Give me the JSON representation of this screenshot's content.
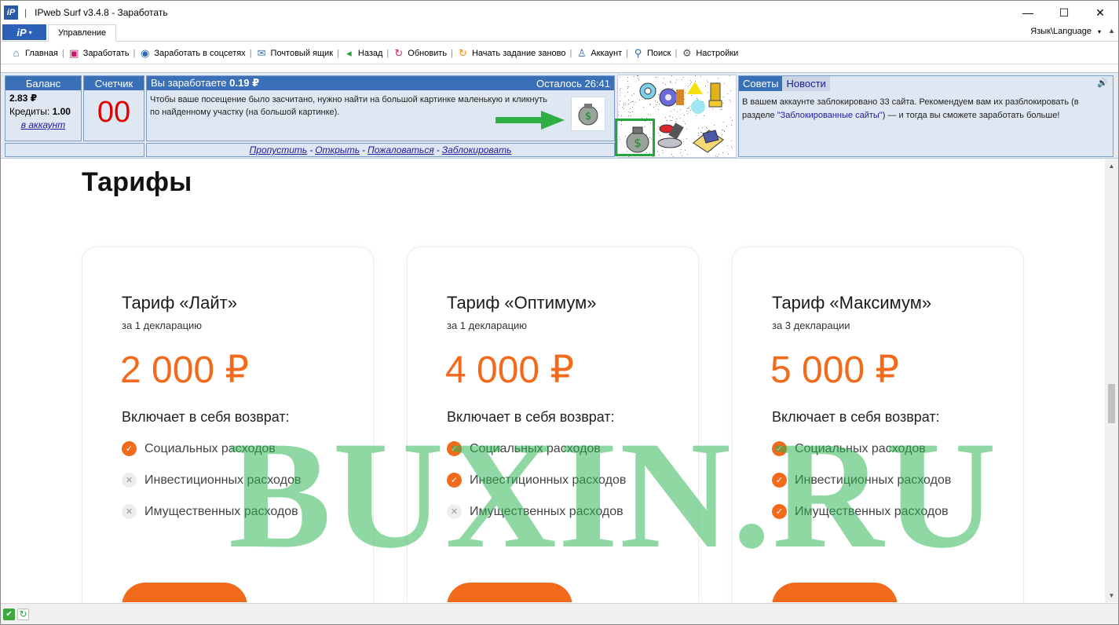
{
  "window": {
    "title": "IPweb Surf v3.4.8 - Заработать",
    "logo": "iP",
    "separator": "|",
    "minimize": "—",
    "maximize": "☐",
    "close": "✕"
  },
  "ribbon": {
    "menu_label": "iP",
    "menu_caret": "▾",
    "active_tab": "Управление",
    "language": "Язык\\Language",
    "language_caret": "▾",
    "scroll_arrow": "▲"
  },
  "toolbar": {
    "items": [
      {
        "label": "Главная",
        "icon": "home-icon",
        "glyph": "⌂",
        "color": "#3a6fb4"
      },
      {
        "label": "Заработать",
        "icon": "wallet-icon",
        "glyph": "▣",
        "color": "#c71a6a"
      },
      {
        "label": "Заработать в соцсетях",
        "icon": "social-icon",
        "glyph": "◉",
        "color": "#2a67b0"
      },
      {
        "label": "Почтовый ящик",
        "icon": "mail-icon",
        "glyph": "✉",
        "color": "#3a6fb4"
      },
      {
        "label": "Назад",
        "icon": "back-icon",
        "glyph": "◂",
        "color": "#2a9c3a"
      },
      {
        "label": "Обновить",
        "icon": "refresh-icon",
        "glyph": "↻",
        "color": "#d4236b"
      },
      {
        "label": "Начать задание заново",
        "icon": "restart-icon",
        "glyph": "↻",
        "color": "#f28c1b"
      },
      {
        "label": "Аккаунт",
        "icon": "user-icon",
        "glyph": "♙",
        "color": "#2a67b0"
      },
      {
        "label": "Поиск",
        "icon": "search-icon",
        "glyph": "⚲",
        "color": "#2a67b0"
      },
      {
        "label": "Настройки",
        "icon": "gear-icon",
        "glyph": "⚙",
        "color": "#555555"
      }
    ],
    "separator": "|"
  },
  "panel": {
    "balance": {
      "header": "Баланс",
      "amount": "2.83 ₽",
      "credits_label": "Кредиты:",
      "credits_value": "1.00",
      "account_link": "в аккаунт"
    },
    "counter": {
      "header": "Счетчик",
      "value": "00"
    },
    "task": {
      "earn_prefix": "Вы заработаете",
      "earn_amount": "0.19 ₽",
      "remaining": "Осталось 26:41",
      "instruction": "Чтобы ваше посещение было засчитано, нужно найти на большой картинке маленькую и кликнуть по найденному участку (на большой картинке)."
    },
    "links": {
      "skip": "Пропустить",
      "open": "Открыть",
      "complain": "Пожаловаться",
      "block": "Заблокировать",
      "dash": "-"
    },
    "news": {
      "tab_tips": "Советы",
      "tab_news": "Новости",
      "speaker": "🔊",
      "text_before": "В вашем аккаунте заблокировано 33 сайта. Рекомендуем вам их разблокировать (в разделе ",
      "link": "\"Заблокированные сайты\"",
      "text_after": ") — и тогда вы сможете заработать больше!"
    }
  },
  "page": {
    "heading": "Тарифы",
    "includes_label": "Включает в себя возврат:",
    "cards": [
      {
        "title": "Тариф «Лайт»",
        "subtitle": "за 1 декларацию",
        "price": "2 000 ₽",
        "features": [
          {
            "label": "Социальных расходов",
            "included": true
          },
          {
            "label": "Инвестиционных расходов",
            "included": false
          },
          {
            "label": "Имущественных расходов",
            "included": false
          }
        ]
      },
      {
        "title": "Тариф «Оптимум»",
        "subtitle": "за 1 декларацию",
        "price": "4 000 ₽",
        "features": [
          {
            "label": "Социальных расходов",
            "included": true
          },
          {
            "label": "Инвестиционных расходов",
            "included": true
          },
          {
            "label": "Имущественных расходов",
            "included": false
          }
        ]
      },
      {
        "title": "Тариф «Максимум»",
        "subtitle": "за 3 декларации",
        "price": "5 000 ₽",
        "features": [
          {
            "label": "Социальных расходов",
            "included": true
          },
          {
            "label": "Инвестиционных расходов",
            "included": true
          },
          {
            "label": "Имущественных расходов",
            "included": true
          }
        ]
      }
    ],
    "check_glyph": "✓",
    "cross_glyph": "✕",
    "watermark": "BUXIN.RU"
  },
  "scrollbar": {
    "up": "▲",
    "down": "▼"
  },
  "colors": {
    "accent": "#f26a1b",
    "header_blue": "#3a70b7",
    "counter_red": "#e00000",
    "watermark_green": "#28b450",
    "highlight_green": "#22a83a"
  }
}
